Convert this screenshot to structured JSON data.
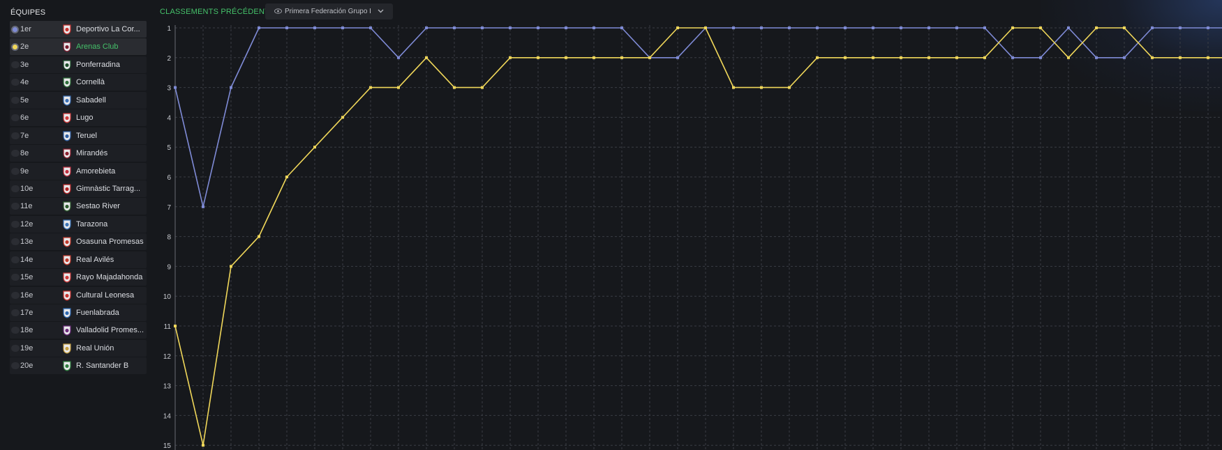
{
  "sidebar": {
    "title": "ÉQUIPES",
    "teams": [
      {
        "rank": "1er",
        "name": "Deportivo La Cor...",
        "crest": "deportivo-crest",
        "toggle_color": "#7f8bd6",
        "highlighted": true
      },
      {
        "rank": "2e",
        "name": "Arenas Club",
        "crest": "arenas-crest",
        "toggle_color": "#f0d75a",
        "highlighted": true,
        "selected": true
      },
      {
        "rank": "3e",
        "name": "Ponferradina",
        "crest": "ponferradina-crest"
      },
      {
        "rank": "4e",
        "name": "Cornellà",
        "crest": "cornella-crest"
      },
      {
        "rank": "5e",
        "name": "Sabadell",
        "crest": "sabadell-crest"
      },
      {
        "rank": "6e",
        "name": "Lugo",
        "crest": "lugo-crest"
      },
      {
        "rank": "7e",
        "name": "Teruel",
        "crest": "teruel-crest"
      },
      {
        "rank": "8e",
        "name": "Mirandés",
        "crest": "mirandes-crest"
      },
      {
        "rank": "9e",
        "name": "Amorebieta",
        "crest": "amorebieta-crest"
      },
      {
        "rank": "10e",
        "name": "Gimnàstic Tarrag...",
        "crest": "gimnastic-crest"
      },
      {
        "rank": "11e",
        "name": "Sestao River",
        "crest": "sestao-crest"
      },
      {
        "rank": "12e",
        "name": "Tarazona",
        "crest": "tarazona-crest"
      },
      {
        "rank": "13e",
        "name": "Osasuna Promesas",
        "crest": "osasuna-crest"
      },
      {
        "rank": "14e",
        "name": "Real Avilés",
        "crest": "aviles-crest"
      },
      {
        "rank": "15e",
        "name": "Rayo Majadahonda",
        "crest": "majadahonda-crest"
      },
      {
        "rank": "16e",
        "name": "Cultural Leonesa",
        "crest": "leonesa-crest"
      },
      {
        "rank": "17e",
        "name": "Fuenlabrada",
        "crest": "fuenlabrada-crest"
      },
      {
        "rank": "18e",
        "name": "Valladolid Promes...",
        "crest": "valladolid-crest"
      },
      {
        "rank": "19e",
        "name": "Real Unión",
        "crest": "union-crest"
      },
      {
        "rank": "20e",
        "name": "R. Santander B",
        "crest": "santander-crest"
      }
    ]
  },
  "header": {
    "title": "CLASSEMENTS PRÉCÉDENTS",
    "league_select": {
      "value": "Primera Federación Grupo I",
      "icon": "eye-icon",
      "chevron": "chevron-down-icon"
    }
  },
  "colors": {
    "series1": "#7f8bd6",
    "series2": "#f0d75a",
    "selected_text": "#45c26a",
    "grid": "#3a3d44"
  },
  "chart_data": {
    "type": "line",
    "y_ticks": [
      1,
      2,
      3,
      4,
      5,
      6,
      7,
      8,
      9,
      10,
      11,
      12,
      13,
      14,
      15
    ],
    "ylim": [
      1,
      15
    ],
    "y_inverted": true,
    "grid": true,
    "series": [
      {
        "color": "#7f8bd6",
        "values": [
          3,
          7,
          3,
          1,
          1,
          1,
          1,
          1,
          2,
          1,
          1,
          1,
          1,
          1,
          1,
          1,
          1,
          2,
          2,
          1,
          1,
          1,
          1,
          1,
          1,
          1,
          1,
          1,
          1,
          1,
          2,
          2,
          1,
          2,
          2,
          1,
          1,
          1,
          1
        ]
      },
      {
        "color": "#f0d75a",
        "values": [
          11,
          15,
          9,
          8,
          6,
          5,
          4,
          3,
          3,
          2,
          3,
          3,
          2,
          2,
          2,
          2,
          2,
          2,
          1,
          1,
          3,
          3,
          3,
          2,
          2,
          2,
          2,
          2,
          2,
          2,
          1,
          1,
          2,
          1,
          1,
          2,
          2,
          2,
          2
        ]
      }
    ]
  }
}
